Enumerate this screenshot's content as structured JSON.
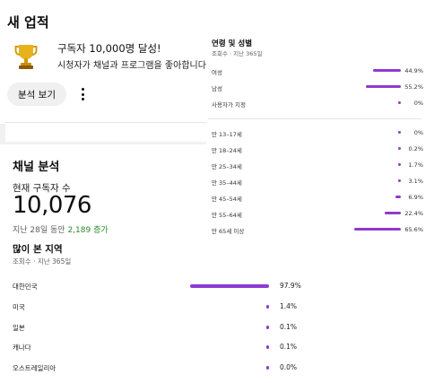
{
  "milestone": {
    "section_title": "새 업적",
    "trophy_icon": "trophy-icon",
    "heading": "구독자 10,000명 달성!",
    "subtext": "시청자가 채널과 프로그램을 좋아합니다",
    "analytics_button": "분석 보기",
    "more_icon": "more-vert-icon"
  },
  "channel": {
    "section_title": "채널 분석",
    "subs_label": "현재 구독자 수",
    "subs_count": "10,076",
    "change_prefix": "지난 28일 동안",
    "change_value": "2,189 증가",
    "change_color": "#2a8a2a"
  },
  "geography": {
    "title": "많이 본 지역",
    "subtitle": "조회수 · 지난 365일",
    "bar_color": "#8e3ad0",
    "rows": [
      {
        "label": "대한민국",
        "pct": "97.9%",
        "value": 97.9
      },
      {
        "label": "미국",
        "pct": "1.4%",
        "value": 1.4
      },
      {
        "label": "일본",
        "pct": "0.1%",
        "value": 0.1
      },
      {
        "label": "캐나다",
        "pct": "0.1%",
        "value": 0.1
      },
      {
        "label": "오스트레일리아",
        "pct": "0.0%",
        "value": 0.0
      }
    ]
  },
  "demographics": {
    "title": "연령 및 성별",
    "subtitle": "조회수 · 지난 365일",
    "gender": [
      {
        "label": "여성",
        "pct": "44.9%",
        "value": 44.9
      },
      {
        "label": "남성",
        "pct": "55.2%",
        "value": 55.2
      },
      {
        "label": "사용자가 지정",
        "pct": "0%",
        "value": 0
      }
    ],
    "age": [
      {
        "label": "만 13–17세",
        "pct": "0%",
        "value": 0
      },
      {
        "label": "만 18–24세",
        "pct": "0.2%",
        "value": 0.2
      },
      {
        "label": "만 25–34세",
        "pct": "1.7%",
        "value": 1.7
      },
      {
        "label": "만 35–44세",
        "pct": "3.1%",
        "value": 3.1
      },
      {
        "label": "만 45–54세",
        "pct": "6.9%",
        "value": 6.9
      },
      {
        "label": "만 55–64세",
        "pct": "22.4%",
        "value": 22.4
      },
      {
        "label": "만 65세 이상",
        "pct": "65.6%",
        "value": 65.6
      }
    ]
  }
}
